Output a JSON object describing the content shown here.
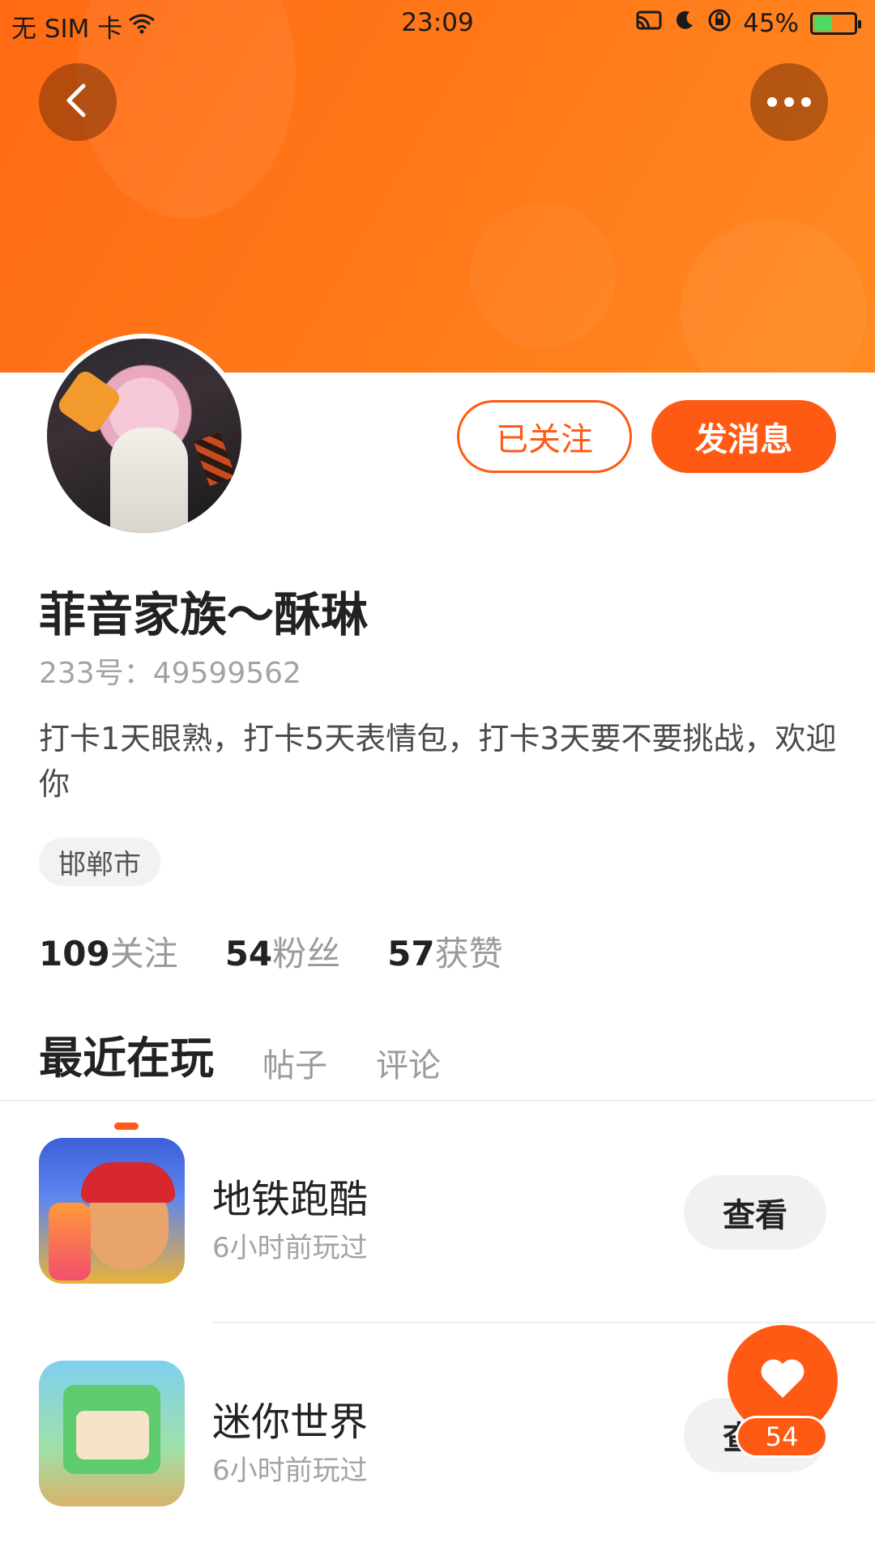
{
  "status_bar": {
    "carrier": "无 SIM 卡",
    "time": "23:09",
    "battery": "45%",
    "battery_level": 0.45
  },
  "header": {
    "back_icon": "chevron-left-icon",
    "more_icon": "more-dots-icon"
  },
  "profile": {
    "follow_label": "已关注",
    "message_label": "发消息",
    "name": "菲音家族～酥琳",
    "uid": "233号：49599562",
    "bio": "打卡1天眼熟，打卡5天表情包，打卡3天要不要挑战，欢迎你",
    "location": "邯郸市"
  },
  "stats": [
    {
      "num": "109",
      "label": "关注"
    },
    {
      "num": "54",
      "label": "粉丝"
    },
    {
      "num": "57",
      "label": "获赞"
    }
  ],
  "tabs": [
    {
      "label": "最近在玩",
      "active": true
    },
    {
      "label": "帖子",
      "active": false
    },
    {
      "label": "评论",
      "active": false
    }
  ],
  "games": [
    {
      "title": "地铁跑酷",
      "subtitle": "6小时前玩过",
      "action": "查看"
    },
    {
      "title": "迷你世界",
      "subtitle": "6小时前玩过",
      "action": "查看"
    }
  ],
  "like": {
    "count": "54"
  },
  "colors": {
    "accent": "#ff5a14",
    "header_gradient_start": "#ff6a13",
    "header_gradient_end": "#ff8a22"
  }
}
